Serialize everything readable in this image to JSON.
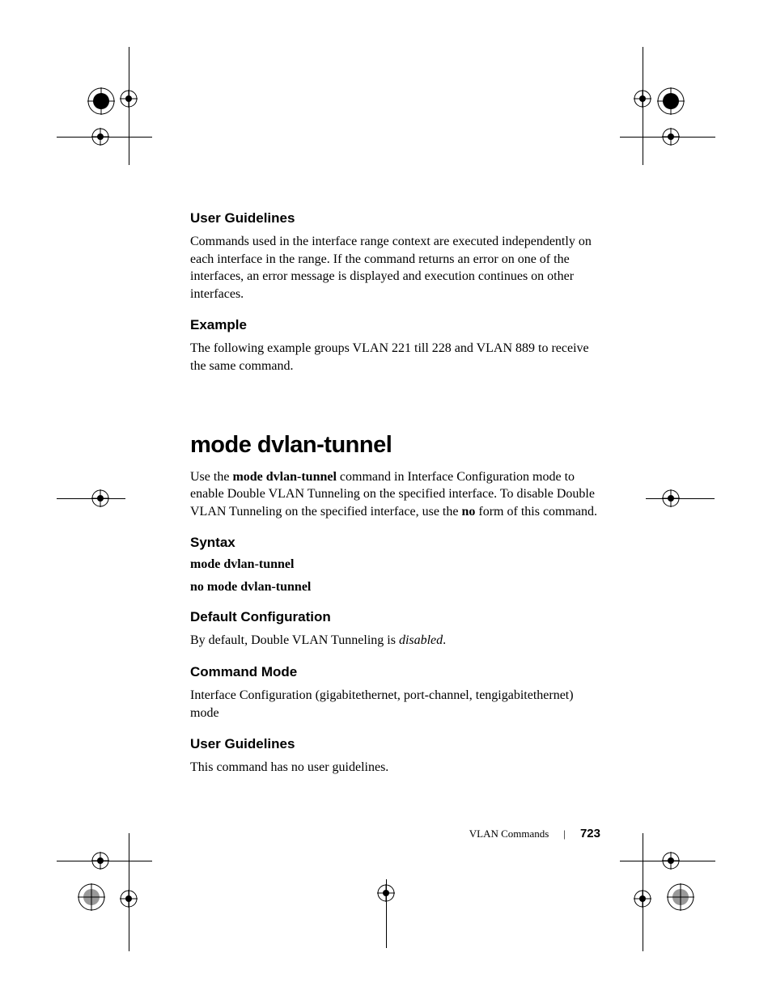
{
  "sections": {
    "user_guidelines_1": {
      "heading": "User Guidelines",
      "body": "Commands used in the interface range context are executed independently on each interface in the range. If the command returns an error on one of the interfaces, an error message is displayed and execution continues on other interfaces."
    },
    "example": {
      "heading": "Example",
      "body": "The following example groups VLAN 221 till 228 and VLAN 889 to receive the same command."
    },
    "command": {
      "title": "mode dvlan-tunnel",
      "intro_pre": "Use the ",
      "intro_cmd": "mode dvlan-tunnel",
      "intro_mid": " command in Interface Configuration mode to enable Double VLAN Tunneling on the specified interface. To disable Double VLAN Tunneling on the specified interface, use the ",
      "intro_no": "no",
      "intro_post": " form of this command."
    },
    "syntax": {
      "heading": "Syntax",
      "line1": "mode dvlan-tunnel",
      "line2": "no mode dvlan-tunnel"
    },
    "default_config": {
      "heading": "Default Configuration",
      "body_pre": " By default, Double VLAN Tunneling is ",
      "body_italic": "disabled",
      "body_post": "."
    },
    "command_mode": {
      "heading": "Command Mode",
      "body": "Interface Configuration (gigabitethernet, port-channel, tengigabitethernet) mode"
    },
    "user_guidelines_2": {
      "heading": "User Guidelines",
      "body": "This command has no user guidelines."
    }
  },
  "footer": {
    "section": "VLAN Commands",
    "page": "723"
  }
}
